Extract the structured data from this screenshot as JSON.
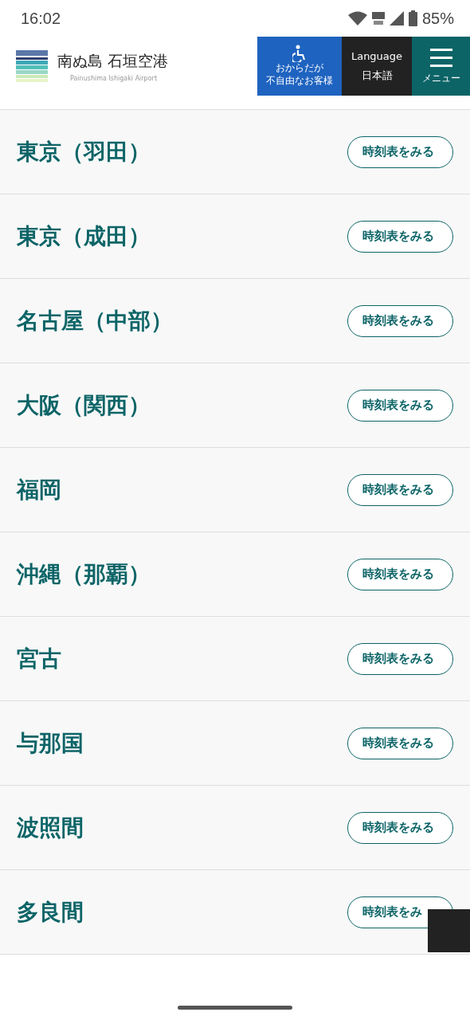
{
  "status_bar": {
    "time": "16:02",
    "battery": "85%"
  },
  "header": {
    "logo_title": "南ぬ島 石垣空港",
    "logo_subtitle": "Painushima Ishigaki Airport",
    "accessibility": [
      "おからだが",
      "不自由なお客様"
    ],
    "language_label": "Language",
    "language_value": "日本語",
    "menu": "メニュー"
  },
  "routes": [
    {
      "name": "東京（羽田）",
      "button": "時刻表をみる"
    },
    {
      "name": "東京（成田）",
      "button": "時刻表をみる"
    },
    {
      "name": "名古屋（中部）",
      "button": "時刻表をみる"
    },
    {
      "name": "大阪（関西）",
      "button": "時刻表をみる"
    },
    {
      "name": "福岡",
      "button": "時刻表をみる"
    },
    {
      "name": "沖縄（那覇）",
      "button": "時刻表をみる"
    },
    {
      "name": "宮古",
      "button": "時刻表をみる"
    },
    {
      "name": "与那国",
      "button": "時刻表をみる"
    },
    {
      "name": "波照間",
      "button": "時刻表をみる"
    },
    {
      "name": "多良間",
      "button": "時刻表をみ"
    }
  ]
}
